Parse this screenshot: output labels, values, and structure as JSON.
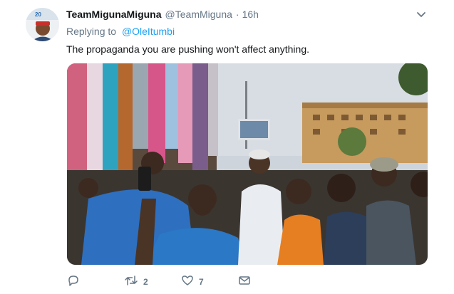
{
  "tweet": {
    "display_name": "TeamMigunaMiguna",
    "handle": "@TeamMiguna",
    "separator": "·",
    "time": "16h",
    "replying_to_label": "Replying to",
    "replying_to_handle": "@OleItumbi",
    "text": "The propaganda you are pushing won't affect anything.",
    "avatar_badge": "20"
  },
  "actions": {
    "reply_icon": "reply-icon",
    "retweet_icon": "retweet-icon",
    "retweet_count": "2",
    "like_icon": "heart-icon",
    "like_count": "7",
    "message_icon": "envelope-icon",
    "menu_icon": "chevron-down-icon"
  },
  "colors": {
    "link": "#1da1f2",
    "secondary_text": "#657786",
    "primary_text": "#14171a"
  }
}
